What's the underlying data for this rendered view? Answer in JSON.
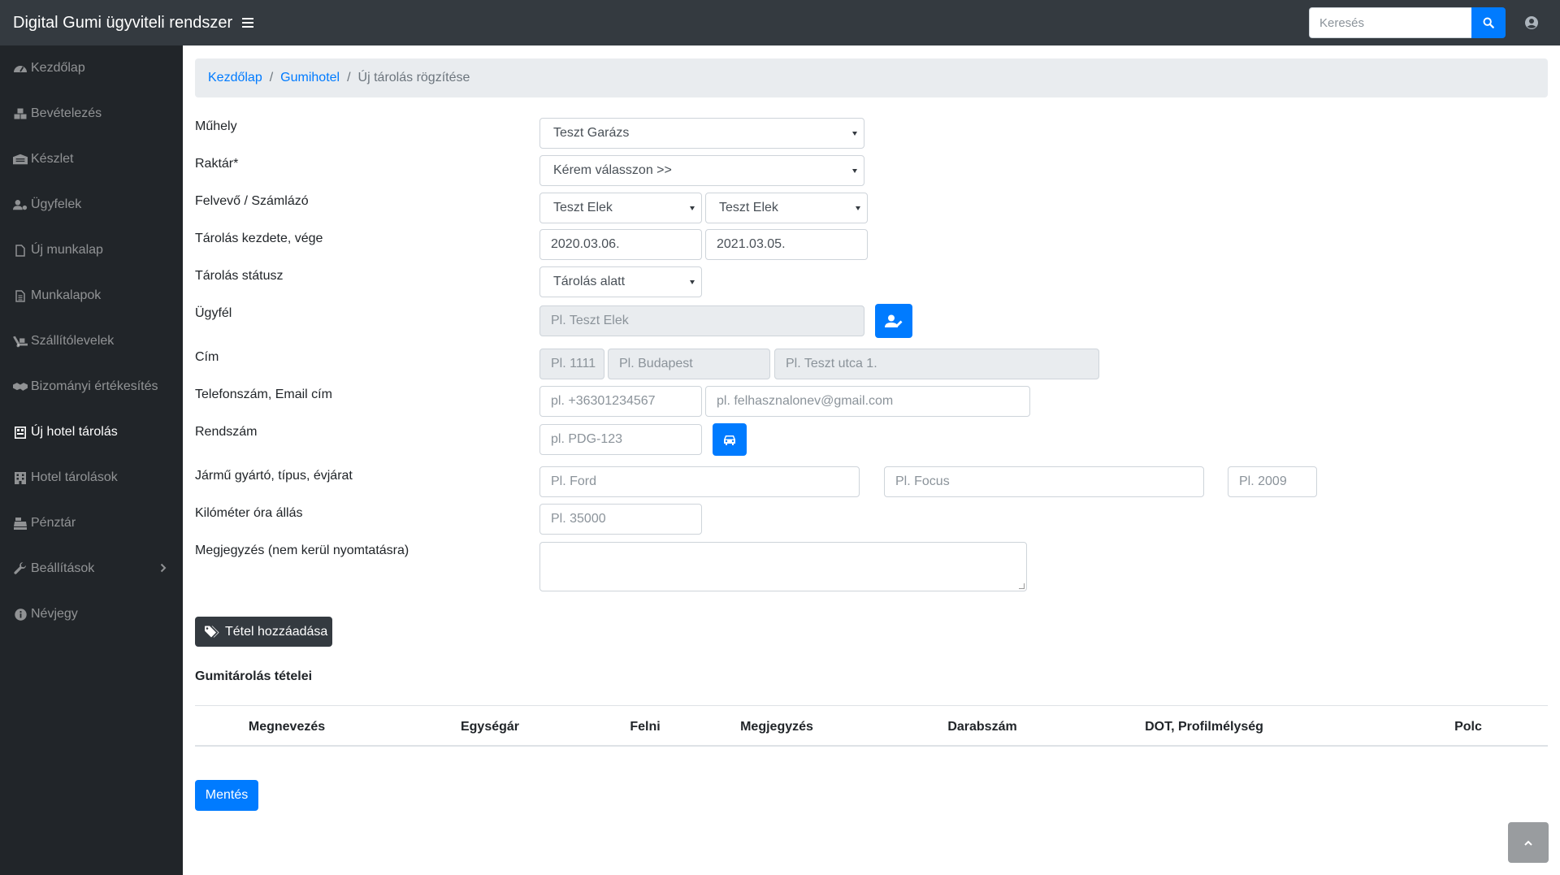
{
  "header": {
    "title": "Digital Gumi ügyviteli rendszer",
    "search_placeholder": "Keresés"
  },
  "sidebar": {
    "items": [
      {
        "label": "Kezdőlap",
        "icon": "tachometer-icon"
      },
      {
        "label": "Bevételezés",
        "icon": "cubes-icon"
      },
      {
        "label": "Készlet",
        "icon": "warehouse-icon"
      },
      {
        "label": "Ügyfelek",
        "icon": "user-cog-icon"
      },
      {
        "label": "Új munkalap",
        "icon": "file-icon"
      },
      {
        "label": "Munkalapok",
        "icon": "file-alt-icon"
      },
      {
        "label": "Szállítólevelek",
        "icon": "truck-loading-icon"
      },
      {
        "label": "Bizományi értékesítés",
        "icon": "handshake-icon"
      },
      {
        "label": "Új hotel tárolás",
        "icon": "hotel-register-icon",
        "active": true
      },
      {
        "label": "Hotel tárolások",
        "icon": "hotel-icon"
      },
      {
        "label": "Pénztár",
        "icon": "cash-register-icon"
      },
      {
        "label": "Beállítások",
        "icon": "wrench-icon"
      },
      {
        "label": "Névjegy",
        "icon": "info-circle-icon"
      }
    ]
  },
  "breadcrumb": {
    "home": "Kezdőlap",
    "section": "Gumihotel",
    "current": "Új tárolás rögzítése",
    "separator": "/"
  },
  "form": {
    "muhely": {
      "label": "Műhely",
      "value": "Teszt Garázs"
    },
    "raktar": {
      "label": "Raktár*",
      "value": "Kérem válasszon >>"
    },
    "felvevo": {
      "label": "Felvevő / Számlázó",
      "felvevo_value": "Teszt Elek",
      "szamlazo_value": "Teszt Elek"
    },
    "tarolas_ido": {
      "label": "Tárolás kezdete, vége",
      "kezdete": "2020.03.06.",
      "vege": "2021.03.05."
    },
    "tarolas_statusz": {
      "label": "Tárolás státusz",
      "value": "Tárolás alatt"
    },
    "ugyfel": {
      "label": "Ügyfél",
      "placeholder": "Pl. Teszt Elek"
    },
    "cim": {
      "label": "Cím",
      "zip_placeholder": "Pl. 1111",
      "city_placeholder": "Pl. Budapest",
      "street_placeholder": "Pl. Teszt utca 1."
    },
    "kapcsolat": {
      "label": "Telefonszám, Email cím",
      "phone_placeholder": "pl. +36301234567",
      "email_placeholder": "pl. felhasznalonev@gmail.com"
    },
    "rendszam": {
      "label": "Rendszám",
      "placeholder": "pl. PDG-123"
    },
    "jarmu": {
      "label": "Jármű gyártó, típus, évjárat",
      "gyarto_placeholder": "Pl. Ford",
      "tipus_placeholder": "Pl. Focus",
      "evjarat_placeholder": "Pl. 2009"
    },
    "km": {
      "label": "Kilóméter óra állás",
      "placeholder": "Pl. 35000"
    },
    "megjegyzes": {
      "label": "Megjegyzés (nem kerül nyomtatásra)"
    }
  },
  "add_item_button": "Tétel hozzáadása",
  "items_section": {
    "title": "Gumitárolás tételei",
    "columns": [
      "Megnevezés",
      "Egységár",
      "Felni",
      "Megjegyzés",
      "Darabszám",
      "DOT, Profilmélység",
      "Polc"
    ]
  },
  "save_button": "Mentés"
}
